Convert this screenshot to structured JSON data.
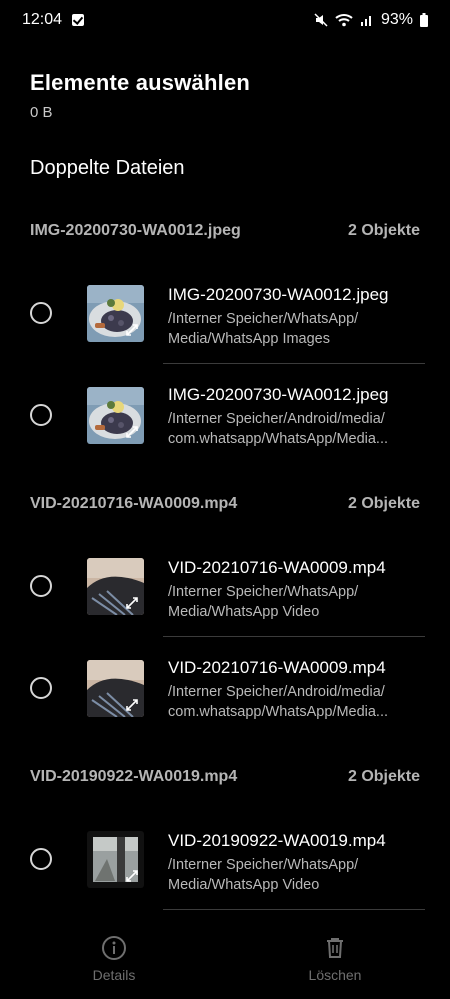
{
  "status_bar": {
    "time": "12:04",
    "battery": "93%"
  },
  "header": {
    "title": "Elemente auswählen",
    "size": "0 B"
  },
  "section": {
    "title": "Doppelte Dateien"
  },
  "groups": [
    {
      "name": "IMG-20200730-WA0012.jpeg",
      "count": "2 Objekte",
      "items": [
        {
          "filename": "IMG-20200730-WA0012.jpeg",
          "path_line1": "/Interner Speicher/WhatsApp/",
          "path_line2": "Media/WhatsApp Images"
        },
        {
          "filename": "IMG-20200730-WA0012.jpeg",
          "path_line1": "/Interner Speicher/Android/media/",
          "path_line2": "com.whatsapp/WhatsApp/Media..."
        }
      ]
    },
    {
      "name": "VID-20210716-WA0009.mp4",
      "count": "2 Objekte",
      "items": [
        {
          "filename": "VID-20210716-WA0009.mp4",
          "path_line1": "/Interner Speicher/WhatsApp/",
          "path_line2": "Media/WhatsApp Video"
        },
        {
          "filename": "VID-20210716-WA0009.mp4",
          "path_line1": "/Interner Speicher/Android/media/",
          "path_line2": "com.whatsapp/WhatsApp/Media..."
        }
      ]
    },
    {
      "name": "VID-20190922-WA0019.mp4",
      "count": "2 Objekte",
      "items": [
        {
          "filename": "VID-20190922-WA0019.mp4",
          "path_line1": "/Interner Speicher/WhatsApp/",
          "path_line2": "Media/WhatsApp Video"
        }
      ]
    }
  ],
  "bottom_bar": {
    "details_label": "Details",
    "delete_label": "Löschen"
  },
  "icons": {
    "details": "info-icon",
    "delete": "trash-icon",
    "expand": "expand-icon"
  },
  "colors": {
    "background": "#000000",
    "muted_text": "#b5b5b5",
    "disabled": "#6f6f6f"
  }
}
